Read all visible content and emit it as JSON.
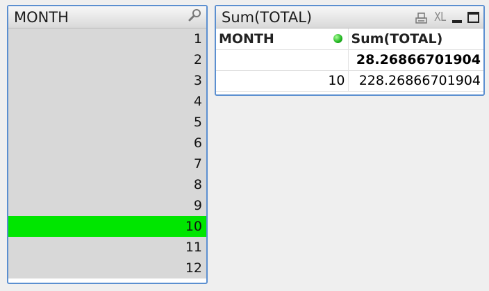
{
  "listbox": {
    "title": "MONTH",
    "items": [
      {
        "label": "1",
        "selected": false
      },
      {
        "label": "2",
        "selected": false
      },
      {
        "label": "3",
        "selected": false
      },
      {
        "label": "4",
        "selected": false
      },
      {
        "label": "5",
        "selected": false
      },
      {
        "label": "6",
        "selected": false
      },
      {
        "label": "7",
        "selected": false
      },
      {
        "label": "8",
        "selected": false
      },
      {
        "label": "9",
        "selected": false
      },
      {
        "label": "10",
        "selected": true
      },
      {
        "label": "11",
        "selected": false
      },
      {
        "label": "12",
        "selected": false
      }
    ],
    "selected_color": "#00e600"
  },
  "table": {
    "title": "Sum(TOTAL)",
    "xl_label": "XL",
    "headers": {
      "dimension": "MONTH",
      "measure": "Sum(TOTAL)"
    },
    "total_row": {
      "dimension": "",
      "value": "28.26866701904"
    },
    "rows": [
      {
        "dimension": "10",
        "value": "228.26866701904"
      }
    ]
  },
  "colors": {
    "border": "#5b8fd0",
    "sort_indicator": "#1fb41f"
  },
  "icons": [
    "search-icon",
    "print-icon",
    "xl-export-icon",
    "minimize-icon",
    "maximize-icon",
    "sort-indicator-icon"
  ]
}
